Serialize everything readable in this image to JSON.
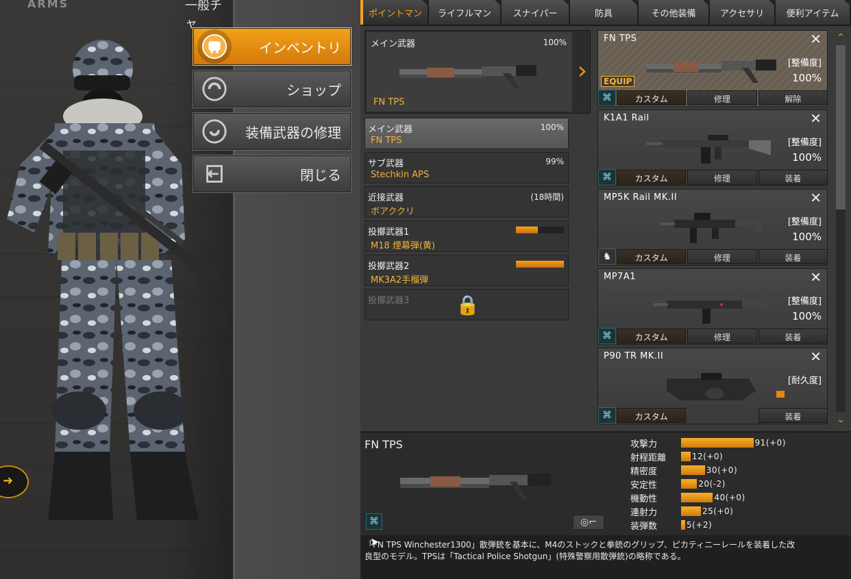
{
  "header": {
    "logo": "ARMS",
    "channel_text": "一般チャ"
  },
  "menu": [
    {
      "label": "インベントリ",
      "icon": "inventory-icon",
      "active": true
    },
    {
      "label": "ショップ",
      "icon": "shop-icon",
      "active": false
    },
    {
      "label": "装備武器の修理",
      "icon": "repair-icon",
      "active": false
    },
    {
      "label": "閉じる",
      "icon": "exit-icon",
      "active": false
    }
  ],
  "tabs": [
    "ポイントマン",
    "ライフルマン",
    "スナイパー",
    "防具",
    "その他装備",
    "アクセサリ",
    "便利アイテム"
  ],
  "loadout": {
    "main": {
      "title": "メイン武器",
      "durability": "100%",
      "name": "FN TPS"
    },
    "slots": [
      {
        "label": "メイン武器",
        "value": "FN TPS",
        "durability": "100%",
        "selected": true
      },
      {
        "label": "サブ武器",
        "value": "Stechkin APS",
        "durability": "99%"
      },
      {
        "label": "近接武器",
        "value": "ボアククリ",
        "durability": "(18時間)"
      },
      {
        "label": "投擲武器1",
        "value": "M18 煙幕弾(黄)",
        "bar": 0.45
      },
      {
        "label": "投擲武器2",
        "value": "MK3A2手榴弾",
        "bar": 1.0
      },
      {
        "label": "投擲武器3",
        "value": "",
        "locked": true
      }
    ]
  },
  "inventory": [
    {
      "name": "FN TPS",
      "stat_label": "[整備度]",
      "stat_value": "100%",
      "equipped": true,
      "equip_label": "EQUIP",
      "buttons": [
        "カスタム",
        "修理",
        "解除"
      ]
    },
    {
      "name": "K1A1 Rail",
      "stat_label": "[整備度]",
      "stat_value": "100%",
      "buttons": [
        "カスタム",
        "修理",
        "装着"
      ]
    },
    {
      "name": "MP5K Rail MK.II",
      "stat_label": "[整備度]",
      "stat_value": "100%",
      "buttons": [
        "カスタム",
        "修理",
        "装着"
      ]
    },
    {
      "name": "MP7A1",
      "stat_label": "[整備度]",
      "stat_value": "100%",
      "buttons": [
        "カスタム",
        "修理",
        "装着"
      ]
    },
    {
      "name": "P90 TR MK.II",
      "stat_label": "[耐久度]",
      "stat_value": "",
      "buttons": [
        "カスタム",
        "",
        "装着"
      ]
    }
  ],
  "detail": {
    "name": "FN TPS",
    "stats": [
      {
        "label": "攻撃力",
        "value": "91(+0)",
        "level": 91
      },
      {
        "label": "射程距離",
        "value": "12(+0)",
        "level": 12
      },
      {
        "label": "精密度",
        "value": "30(+0)",
        "level": 30
      },
      {
        "label": "安定性",
        "value": "20(-2)",
        "level": 20
      },
      {
        "label": "機動性",
        "value": "40(+0)",
        "level": 40
      },
      {
        "label": "連射力",
        "value": "25(+0)",
        "level": 25
      },
      {
        "label": "装弾数",
        "value": "5(+2)",
        "level": 5
      }
    ],
    "description_line1": "「FN TPS Winchester1300」散弾銃を基本に、M4のストックと拳銃のグリップ、ピカティニーレールを装着した改",
    "description_line2": "良型のモデル。TPSは「Tactical Police Shotgun」(特殊警察用散弾銃)の略称である。"
  },
  "colors": {
    "accent": "#f4a31c",
    "weapon_name": "#f0b23a",
    "bar": "#e8850e"
  }
}
